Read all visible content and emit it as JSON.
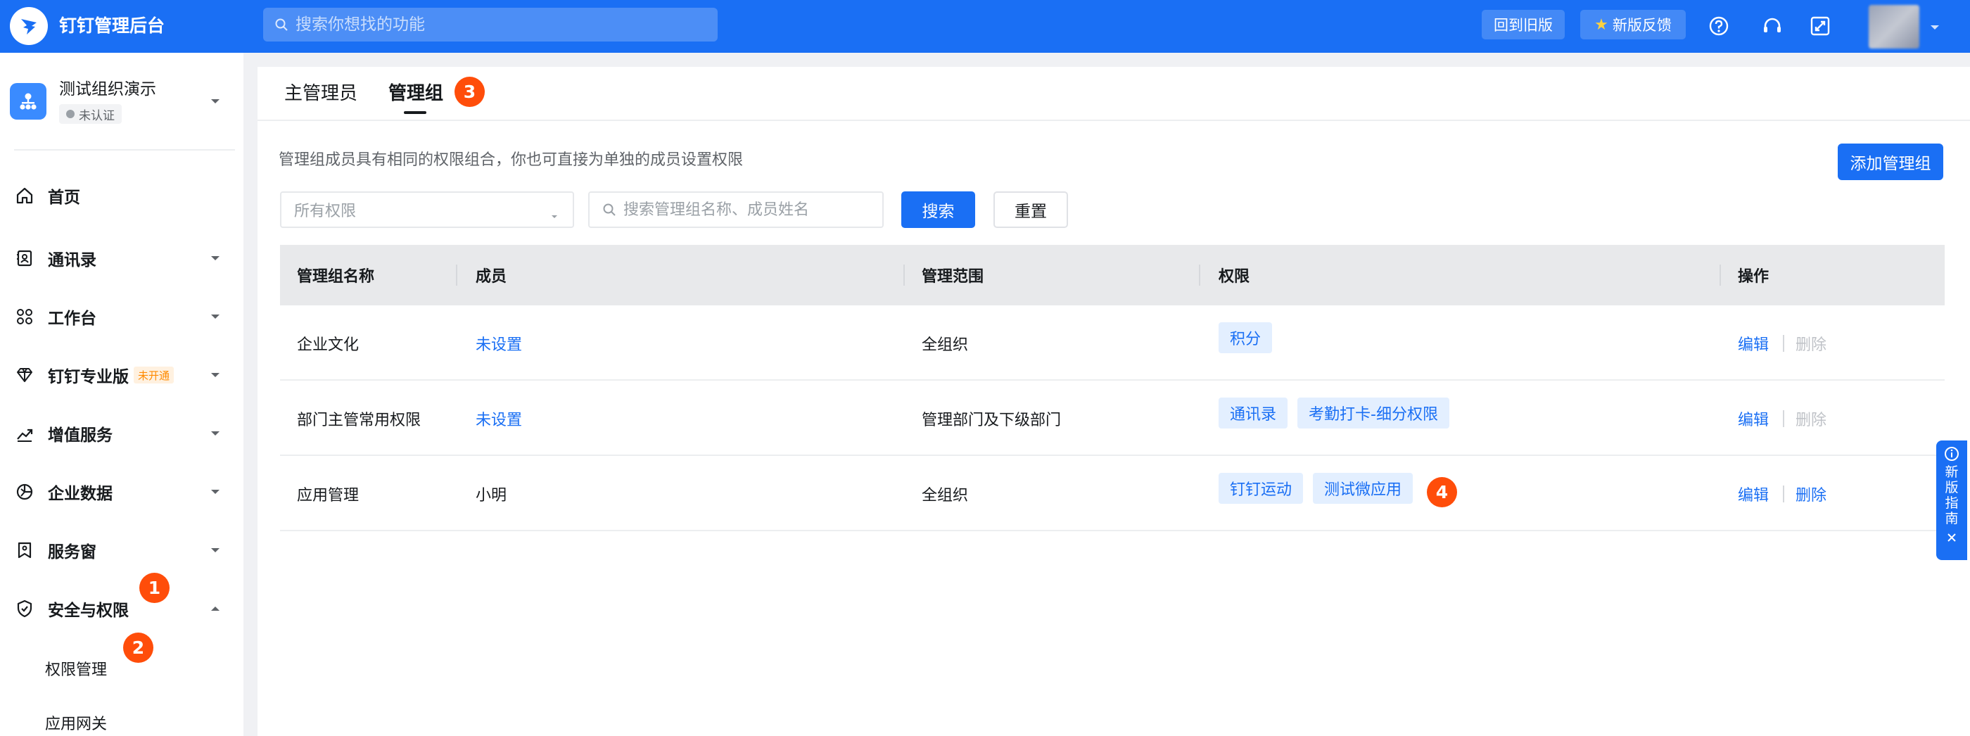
{
  "topbar": {
    "title": "钉钉管理后台",
    "search_placeholder": "搜索你想找的功能",
    "old_version_label": "回到旧版",
    "feedback_label": "新版反馈"
  },
  "org": {
    "name": "测试组织演示",
    "status": "未认证"
  },
  "sidebar": {
    "items": [
      {
        "label": "首页"
      },
      {
        "label": "通讯录"
      },
      {
        "label": "工作台"
      },
      {
        "label": "钉钉专业版",
        "tag": "未开通"
      },
      {
        "label": "增值服务"
      },
      {
        "label": "企业数据"
      },
      {
        "label": "服务窗"
      },
      {
        "label": "安全与权限"
      }
    ],
    "sub_items": [
      {
        "label": "权限管理"
      },
      {
        "label": "应用网关"
      }
    ]
  },
  "steps": [
    "1",
    "2",
    "3",
    "4"
  ],
  "tabs": [
    {
      "label": "主管理员"
    },
    {
      "label": "管理组"
    }
  ],
  "main": {
    "description": "管理组成员具有相同的权限组合，你也可直接为单独的成员设置权限",
    "add_button": "添加管理组",
    "filter_placeholder": "所有权限",
    "search_placeholder": "搜索管理组名称、成员姓名",
    "search_button": "搜索",
    "reset_button": "重置"
  },
  "table": {
    "headers": [
      "管理组名称",
      "成员",
      "管理范围",
      "权限",
      "操作"
    ],
    "rows": [
      {
        "name": "企业文化",
        "members": "未设置",
        "scope": "全组织",
        "perms": [
          "积分"
        ],
        "edit": "编辑",
        "delete": "删除"
      },
      {
        "name": "部门主管常用权限",
        "members": "未设置",
        "scope": "管理部门及下级部门",
        "perms": [
          "通讯录",
          "考勤打卡-细分权限"
        ],
        "edit": "编辑",
        "delete": "删除"
      },
      {
        "name": "应用管理",
        "members": "小明",
        "scope": "全组织",
        "perms": [
          "钉钉运动",
          "测试微应用"
        ],
        "edit": "编辑",
        "delete": "删除"
      }
    ]
  },
  "guide": {
    "label": "新版指南"
  },
  "colors": {
    "primary": "#1a6ff4",
    "step_badge": "#ff4d0a",
    "tag_orange": "#ff8a00"
  }
}
